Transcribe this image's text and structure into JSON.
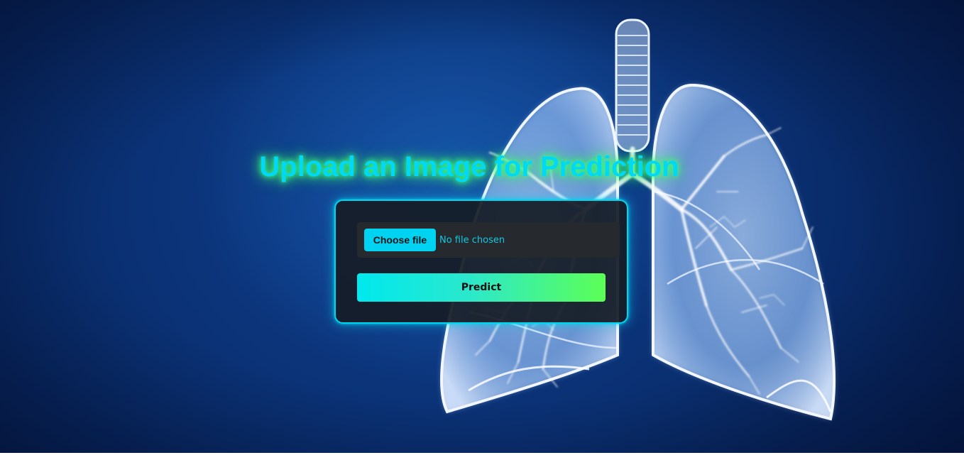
{
  "page": {
    "title": "Upload an Image for Prediction"
  },
  "upload_form": {
    "choose_file_label": "Choose file",
    "file_status": "No file chosen",
    "predict_label": "Predict"
  },
  "background": {
    "image": "lungs-xray-illustration",
    "colors": {
      "deep_blue": "#0a2f70",
      "accent_cyan": "#00d9f5",
      "glow_green": "#3dff7a"
    }
  }
}
